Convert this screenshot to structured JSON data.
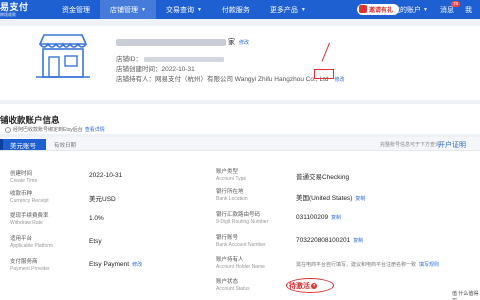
{
  "nav": {
    "logo_main": "易支付",
    "logo_sub": "跨境收款",
    "items": [
      {
        "label": "资金管理",
        "caret": false
      },
      {
        "label": "店铺管理",
        "caret": true
      },
      {
        "label": "交易查询",
        "caret": true
      },
      {
        "label": "付款服务",
        "caret": false
      },
      {
        "label": "更多产品",
        "caret": true
      }
    ],
    "invite": "邀请有礼",
    "account": "我的账户",
    "message": "消息",
    "message_badge": "78",
    "user": "我"
  },
  "store": {
    "name_suffix": "家",
    "edit": "修改",
    "id_label": "店铺ID：",
    "created_label": "店铺创建时间：",
    "created_value": "2022-10-31",
    "owner_label": "店铺持有人：",
    "owner_value": "网易支付（杭州）有限公司  Wangyi Zhifu Hangzhou Co., Ltd",
    "owner_edit": "修改"
  },
  "section": {
    "title": "铺收款账户信息",
    "warning": "经阿巴收款账号绑定到Etsy后台",
    "warning_link": "查看详情"
  },
  "panel": {
    "tab": "美元账号",
    "tag": "有效日期",
    "head_note": "完整账号信息可于下方查询",
    "open_btn": "开户证明"
  },
  "left_fields": [
    {
      "label": "创建时间",
      "label_en": "Create Time",
      "value": "2022-10-31",
      "link": ""
    },
    {
      "label": "收款币种",
      "label_en": "Currency Receipt",
      "value": "美元USD",
      "link": ""
    },
    {
      "label": "提现手续费费率",
      "label_en": "Withdraw Rate",
      "value": "1.0%",
      "link": ""
    },
    {
      "label": "适用平台",
      "label_en": "Applicable Platform",
      "value": "Etsy",
      "link": ""
    },
    {
      "label": "支付服务商",
      "label_en": "Payment Provider",
      "value": "Etsy Payment",
      "link": "修改"
    }
  ],
  "right_fields": [
    {
      "label": "账户类型",
      "label_en": "Account Type",
      "value": "普通交易Checking",
      "link": ""
    },
    {
      "label": "银行所在地",
      "label_en": "Bank Location",
      "value": "美国(United States)",
      "link": "复制"
    },
    {
      "label": "银行汇款路由号码",
      "label_en": "9-Digit Routing Number",
      "value": "031100209",
      "link": "复制"
    },
    {
      "label": "银行账号",
      "label_en": "Bank Account Number",
      "value": "703220808100201",
      "link": "复制"
    },
    {
      "label": "账户持有人",
      "label_en": "Account Holder Name",
      "value": "",
      "link": ""
    },
    {
      "label": "账户状态",
      "label_en": "Account Status",
      "value": "",
      "link": ""
    }
  ],
  "holder_note": "需在电商平台自行填写，建议和电商平台注册名称一致",
  "holder_link": "填写规则",
  "status": {
    "value": "待激活",
    "icon": "?"
  },
  "watermark": "值 什么值得买",
  "colors": {
    "brand": "#1e5fd1",
    "accent_red": "#e03030",
    "link": "#2a6be0"
  }
}
